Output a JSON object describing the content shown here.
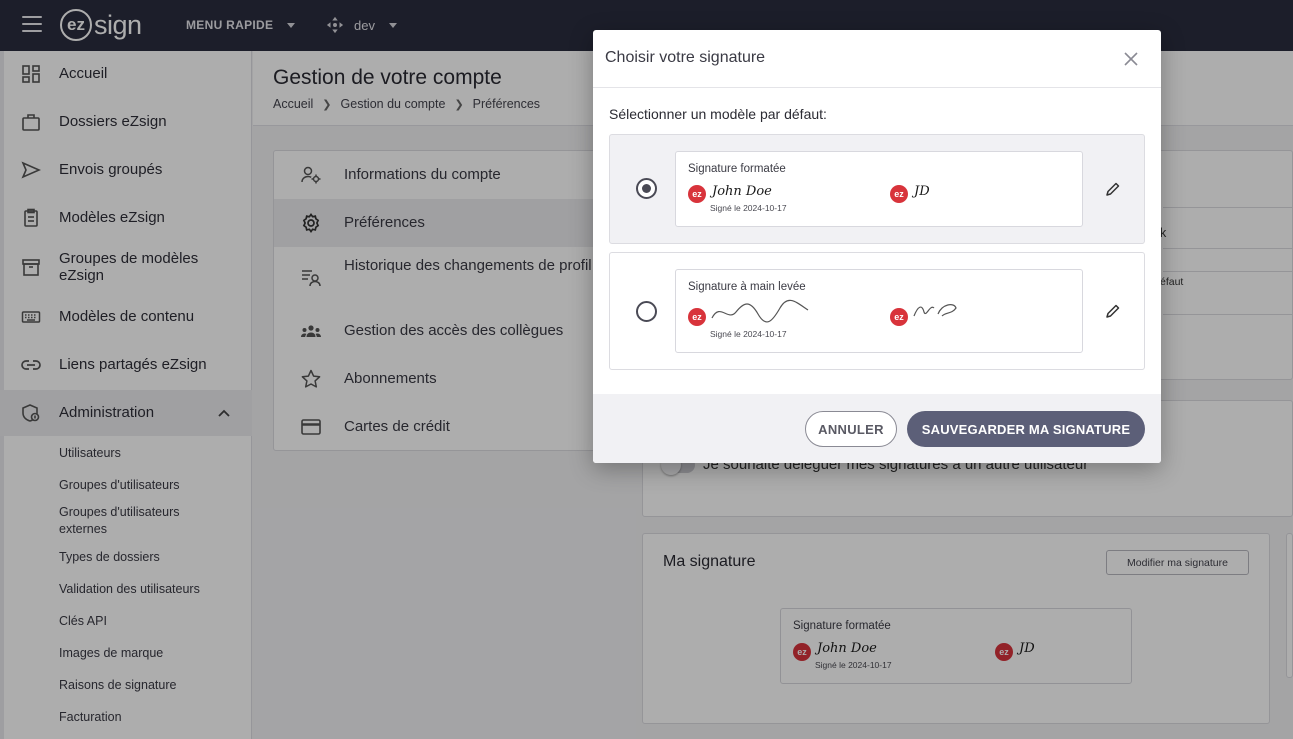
{
  "app": {
    "logo_prefix": "ez",
    "logo_suffix": "sign",
    "quick_menu": "MENU RAPIDE",
    "environment": "dev"
  },
  "sidebar": {
    "items": [
      {
        "label": "Accueil",
        "icon": "dashboard-icon"
      },
      {
        "label": "Dossiers eZsign",
        "icon": "briefcase-icon"
      },
      {
        "label": "Envois groupés",
        "icon": "send-icon"
      },
      {
        "label": "Modèles eZsign",
        "icon": "clipboard-icon"
      },
      {
        "label": "Groupes de modèles eZsign",
        "icon": "archive-icon"
      },
      {
        "label": "Modèles de contenu",
        "icon": "keyboard-icon"
      },
      {
        "label": "Liens partagés eZsign",
        "icon": "link-icon"
      },
      {
        "label": "Administration",
        "icon": "shield-icon"
      }
    ],
    "admin_subitems": [
      "Utilisateurs",
      "Groupes d'utilisateurs",
      "Groupes d'utilisateurs externes",
      "Types de dossiers",
      "Validation des utilisateurs",
      "Clés API",
      "Images de marque",
      "Raisons de signature",
      "Facturation"
    ]
  },
  "page": {
    "title": "Gestion de votre compte",
    "breadcrumb": [
      "Accueil",
      "Gestion du compte",
      "Préférences"
    ]
  },
  "account_menu": [
    {
      "label": "Informations du compte",
      "icon": "user-gear-icon"
    },
    {
      "label": "Préférences",
      "icon": "gear-icon"
    },
    {
      "label": "Historique des changements de profil",
      "icon": "history-list-icon"
    },
    {
      "label": "Gestion des accès des collègues",
      "icon": "team-icon"
    },
    {
      "label": "Abonnements",
      "icon": "star-icon"
    },
    {
      "label": "Cartes de crédit",
      "icon": "credit-card-icon"
    }
  ],
  "background_panel": {
    "partial_1": "k",
    "partial_2": "éfaut",
    "delegate_toggle_label": "Je souhaite déléguer mes signatures à un autre utilisateur",
    "delegate_toggle_on": false,
    "my_signature_title": "Ma signature",
    "edit_signature_button": "Modifier ma signature",
    "current_signature": {
      "title": "Signature formatée",
      "signed_text": "Signé le 2024-10-17",
      "full_name": "John Doe",
      "initials": "JD"
    }
  },
  "modal": {
    "title": "Choisir votre signature",
    "subtitle": "Sélectionner un modèle par défaut:",
    "options": [
      {
        "title": "Signature formatée",
        "signed_text": "Signé le 2024-10-17",
        "full_name": "John Doe",
        "initials": "JD",
        "selected": true
      },
      {
        "title": "Signature à main levée",
        "signed_text": "Signé le 2024-10-17",
        "selected": false
      }
    ],
    "cancel_label": "ANNULER",
    "save_label": "SAUVEGARDER MA SIGNATURE"
  },
  "colors": {
    "topbar": "#2a2d3e",
    "primary_button": "#5c5f78",
    "ez_red": "#d8333b"
  }
}
